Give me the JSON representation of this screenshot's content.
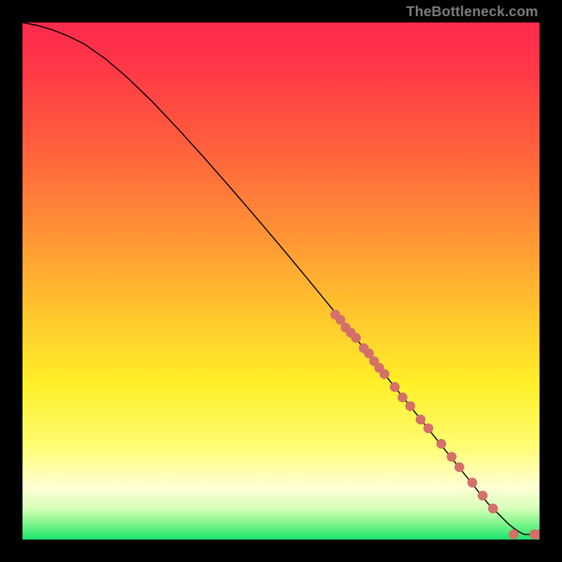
{
  "attribution": "TheBottleneck.com",
  "colors": {
    "line": "#000000",
    "marker_fill": "#d46f6a",
    "marker_stroke": "#a84e49"
  },
  "chart_data": {
    "type": "line",
    "title": "",
    "xlabel": "",
    "ylabel": "",
    "xlim": [
      0,
      100
    ],
    "ylim": [
      0,
      100
    ],
    "grid": false,
    "series": [
      {
        "name": "curve",
        "x": [
          0,
          3,
          6,
          9,
          12,
          16,
          20,
          25,
          30,
          35,
          40,
          45,
          50,
          55,
          60,
          62,
          64,
          66,
          68,
          70,
          72,
          74,
          76,
          78,
          80,
          82,
          84,
          86,
          88,
          90,
          91,
          92,
          93,
          94,
          95,
          96,
          97,
          98,
          100
        ],
        "y": [
          100,
          99.4,
          98.5,
          97.3,
          95.8,
          93.0,
          89.6,
          84.8,
          79.5,
          74.0,
          68.3,
          62.5,
          56.6,
          50.6,
          44.5,
          42.0,
          39.5,
          37.0,
          34.5,
          32.0,
          29.5,
          27.0,
          24.5,
          22.0,
          19.5,
          17.0,
          14.5,
          12.0,
          9.5,
          7.0,
          6.0,
          5.0,
          4.0,
          3.0,
          2.2,
          1.5,
          1.0,
          1.0,
          1.0
        ]
      }
    ],
    "markers": [
      {
        "x": 60.5,
        "y": 43.5
      },
      {
        "x": 61.5,
        "y": 42.5
      },
      {
        "x": 62.5,
        "y": 41.0
      },
      {
        "x": 63.5,
        "y": 40.0
      },
      {
        "x": 64.5,
        "y": 39.0
      },
      {
        "x": 66.0,
        "y": 37.0
      },
      {
        "x": 67.0,
        "y": 36.0
      },
      {
        "x": 68.0,
        "y": 34.5
      },
      {
        "x": 69.0,
        "y": 33.2
      },
      {
        "x": 70.0,
        "y": 32.0
      },
      {
        "x": 72.0,
        "y": 29.5
      },
      {
        "x": 73.5,
        "y": 27.5
      },
      {
        "x": 75.0,
        "y": 25.8
      },
      {
        "x": 77.0,
        "y": 23.2
      },
      {
        "x": 78.5,
        "y": 21.5
      },
      {
        "x": 81.0,
        "y": 18.5
      },
      {
        "x": 83.0,
        "y": 16.0
      },
      {
        "x": 84.5,
        "y": 14.0
      },
      {
        "x": 87.0,
        "y": 11.0
      },
      {
        "x": 89.0,
        "y": 8.5
      },
      {
        "x": 91.0,
        "y": 6.0
      },
      {
        "x": 95.0,
        "y": 1.0
      },
      {
        "x": 99.0,
        "y": 1.0
      },
      {
        "x": 100.0,
        "y": 1.0
      }
    ]
  }
}
